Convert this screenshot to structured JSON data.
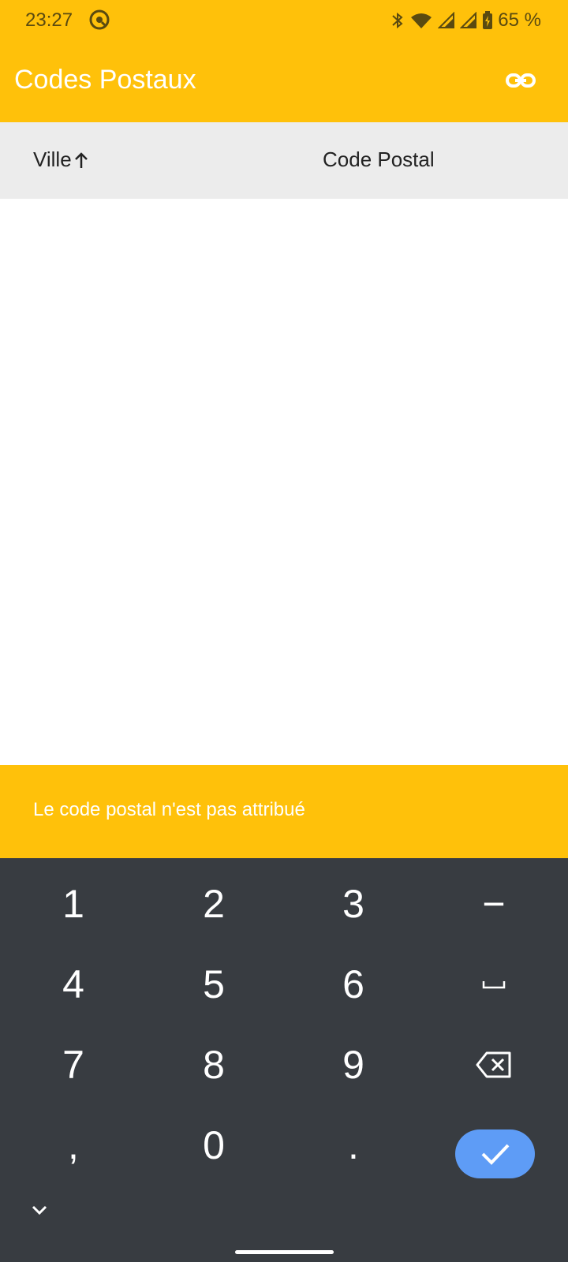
{
  "colors": {
    "accent": "#FFC10A",
    "keyboard_bg": "#383C41",
    "enter_key": "#5E9CF6",
    "header_bg": "#ECECEC"
  },
  "status_bar": {
    "time": "23:27",
    "battery": "65 %",
    "icons": [
      "app-notification-icon",
      "bluetooth-icon",
      "wifi-icon",
      "signal-icon",
      "signal-icon",
      "battery-charging-icon"
    ]
  },
  "app_bar": {
    "title": "Codes Postaux",
    "action_icon": "link-icon"
  },
  "table": {
    "columns": [
      {
        "label": "Ville",
        "sort": "ascending"
      },
      {
        "label": "Code Postal"
      }
    ],
    "rows": []
  },
  "snackbar": {
    "message": "Le code postal n'est pas attribué"
  },
  "keyboard": {
    "keys": [
      {
        "label": "1"
      },
      {
        "label": "2"
      },
      {
        "label": "3"
      },
      {
        "label": "−"
      },
      {
        "label": "4"
      },
      {
        "label": "5"
      },
      {
        "label": "6"
      },
      {
        "label": "␣"
      },
      {
        "label": "7"
      },
      {
        "label": "8"
      },
      {
        "label": "9"
      },
      {
        "label": ""
      },
      {
        "label": ","
      },
      {
        "label": "0"
      },
      {
        "label": "."
      },
      {
        "label": ""
      }
    ]
  }
}
